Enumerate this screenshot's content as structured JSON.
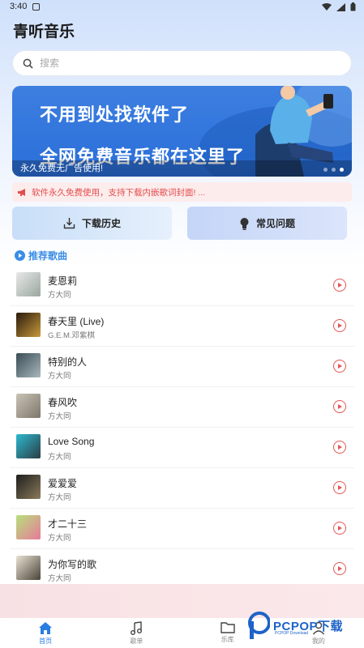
{
  "status_bar": {
    "time": "3:40"
  },
  "app": {
    "title": "青听音乐"
  },
  "search": {
    "placeholder": "搜索"
  },
  "banner": {
    "line1": "不用到处找软件了",
    "line2": "全网免费音乐都在这里了",
    "caption": "永久免费无广告使用!",
    "slide_count": 3,
    "active_slide": 3
  },
  "notice": {
    "text": "软件永久免费使用，支持下载内嵌歌词封面! ..."
  },
  "quick_actions": [
    {
      "label": "下载历史",
      "icon": "download-icon"
    },
    {
      "label": "常见问题",
      "icon": "lightbulb-icon"
    }
  ],
  "section": {
    "title": "推荐歌曲"
  },
  "songs": [
    {
      "title": "麦恩莉",
      "artist": "方大同"
    },
    {
      "title": "春天里 (Live)",
      "artist": "G.E.M.邓紫棋"
    },
    {
      "title": "特别的人",
      "artist": "方大同"
    },
    {
      "title": "春风吹",
      "artist": "方大同"
    },
    {
      "title": "Love Song",
      "artist": "方大同"
    },
    {
      "title": "爱爱爱",
      "artist": "方大同"
    },
    {
      "title": "才二十三",
      "artist": "方大同"
    },
    {
      "title": "为你写的歌",
      "artist": "方大同"
    }
  ],
  "tabs": [
    {
      "label": "首页",
      "icon": "home-icon",
      "active": true
    },
    {
      "label": "歌单",
      "icon": "music-note-icon",
      "active": false
    },
    {
      "label": "乐库",
      "icon": "folder-icon",
      "active": false
    },
    {
      "label": "我的",
      "icon": "user-icon",
      "active": false
    }
  ],
  "watermark": {
    "brand": "PCPOP下载",
    "sub": "PCPOP Download"
  },
  "colors": {
    "accent": "#2a7de1",
    "play": "#e55555",
    "notice": "#e34d4d",
    "banner": "#2a6ed9"
  }
}
